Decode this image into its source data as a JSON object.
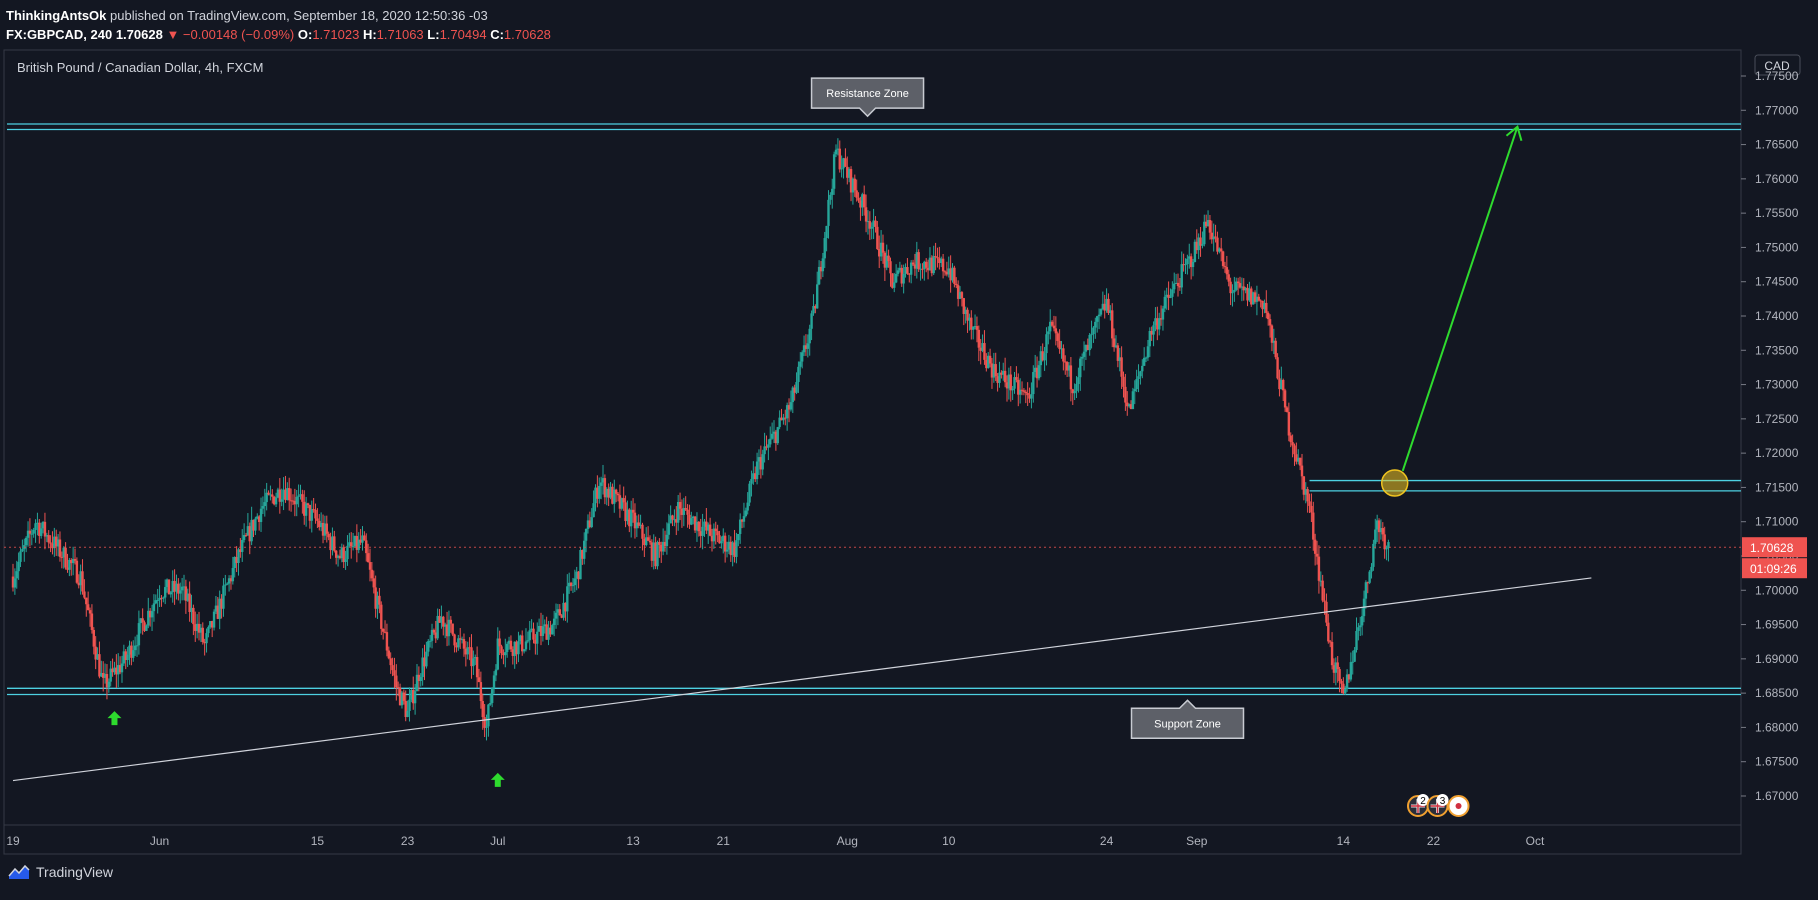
{
  "header": {
    "author": "ThinkingAntsOk",
    "published": "published on TradingView.com, September 18, 2020 12:50:36 -03",
    "symbol_line": "FX:GBPCAD, 240",
    "last": "1.70628",
    "change": "▼ −0.00148 (−0.09%)",
    "o_label": "O:",
    "o": "1.71023",
    "h_label": "H:",
    "h": "1.71063",
    "l_label": "L:",
    "l": "1.70494",
    "c_label": "C:",
    "c": "1.70628"
  },
  "chart_data": {
    "type": "candlestick",
    "title": "British Pound / Canadian Dollar, 4h, FXCM",
    "currency": "CAD",
    "y_ticks": [
      "1.77500",
      "1.77000",
      "1.76500",
      "1.76000",
      "1.75500",
      "1.75000",
      "1.74500",
      "1.74000",
      "1.73500",
      "1.73000",
      "1.72500",
      "1.72000",
      "1.71500",
      "1.71000",
      "1.70500",
      "1.70000",
      "1.69500",
      "1.69000",
      "1.68500",
      "1.68000",
      "1.67500",
      "1.67000"
    ],
    "y_values": [
      1.775,
      1.77,
      1.765,
      1.76,
      1.755,
      1.75,
      1.745,
      1.74,
      1.735,
      1.73,
      1.725,
      1.72,
      1.715,
      1.71,
      1.705,
      1.7,
      1.695,
      1.69,
      1.685,
      1.68,
      1.675,
      1.67
    ],
    "ylim": [
      1.665,
      1.78
    ],
    "x_ticks": [
      "19",
      "Jun",
      "15",
      "23",
      "Jul",
      "13",
      "21",
      "Aug",
      "10",
      "24",
      "Sep",
      "14",
      "22",
      "Oct"
    ],
    "price_path": [
      [
        "2020-05-19",
        1.702
      ],
      [
        "2020-05-21",
        1.71
      ],
      [
        "2020-05-25",
        1.702
      ],
      [
        "2020-05-27",
        1.686
      ],
      [
        "2020-05-29",
        1.69
      ],
      [
        "2020-06-01",
        1.7
      ],
      [
        "2020-06-03",
        1.7
      ],
      [
        "2020-06-05",
        1.692
      ],
      [
        "2020-06-08",
        1.705
      ],
      [
        "2020-06-10",
        1.712
      ],
      [
        "2020-06-12",
        1.715
      ],
      [
        "2020-06-15",
        1.71
      ],
      [
        "2020-06-17",
        1.705
      ],
      [
        "2020-06-19",
        1.707
      ],
      [
        "2020-06-22",
        1.686
      ],
      [
        "2020-06-23",
        1.682
      ],
      [
        "2020-06-24",
        1.688
      ],
      [
        "2020-06-26",
        1.696
      ],
      [
        "2020-06-29",
        1.689
      ],
      [
        "2020-06-30",
        1.68
      ],
      [
        "2020-07-01",
        1.692
      ],
      [
        "2020-07-03",
        1.692
      ],
      [
        "2020-07-06",
        1.695
      ],
      [
        "2020-07-08",
        1.702
      ],
      [
        "2020-07-10",
        1.716
      ],
      [
        "2020-07-13",
        1.71
      ],
      [
        "2020-07-15",
        1.705
      ],
      [
        "2020-07-17",
        1.712
      ],
      [
        "2020-07-20",
        1.708
      ],
      [
        "2020-07-22",
        1.706
      ],
      [
        "2020-07-24",
        1.718
      ],
      [
        "2020-07-27",
        1.727
      ],
      [
        "2020-07-29",
        1.74
      ],
      [
        "2020-07-31",
        1.764
      ],
      [
        "2020-08-03",
        1.754
      ],
      [
        "2020-08-05",
        1.745
      ],
      [
        "2020-08-07",
        1.748
      ],
      [
        "2020-08-10",
        1.747
      ],
      [
        "2020-08-12",
        1.738
      ],
      [
        "2020-08-14",
        1.732
      ],
      [
        "2020-08-17",
        1.728
      ],
      [
        "2020-08-19",
        1.738
      ],
      [
        "2020-08-21",
        1.73
      ],
      [
        "2020-08-24",
        1.742
      ],
      [
        "2020-08-26",
        1.726
      ],
      [
        "2020-08-28",
        1.738
      ],
      [
        "2020-09-01",
        1.75
      ],
      [
        "2020-09-02",
        1.754
      ],
      [
        "2020-09-04",
        1.744
      ],
      [
        "2020-09-07",
        1.742
      ],
      [
        "2020-09-09",
        1.725
      ],
      [
        "2020-09-11",
        1.712
      ],
      [
        "2020-09-13",
        1.69
      ],
      [
        "2020-09-14",
        1.684
      ],
      [
        "2020-09-16",
        1.7
      ],
      [
        "2020-09-17",
        1.71
      ],
      [
        "2020-09-18",
        1.70628
      ]
    ],
    "current_price": "1.70628",
    "countdown": "01:09:26",
    "resistance_zone": [
      1.7672,
      1.768
    ],
    "breakout_zone": [
      1.7145,
      1.716
    ],
    "support_zone": [
      1.6848,
      1.6857
    ],
    "trendline": [
      [
        "2020-05-19",
        1.674
      ],
      [
        "2020-10-06",
        1.7018
      ]
    ],
    "target_arrow": [
      [
        "2020-09-19",
        1.7155
      ],
      [
        "2020-09-29",
        1.7676
      ]
    ],
    "annotations": [
      {
        "text": "Resistance Zone",
        "date": "2020-08-02",
        "price": 1.7725
      },
      {
        "text": "Support Zone",
        "date": "2020-08-31",
        "price": 1.6806
      }
    ],
    "markers": [
      {
        "date": "2020-05-28",
        "price": 1.6812,
        "type": "up-arrow"
      },
      {
        "date": "2020-07-01",
        "price": 1.6722,
        "type": "up-arrow"
      }
    ],
    "events": [
      {
        "date": "2020-09-20",
        "count": "2"
      },
      {
        "date": "2020-09-22",
        "count": "3"
      }
    ],
    "colors": {
      "background": "#131722",
      "up": "#26a69a",
      "down": "#ef5350",
      "zone": "#4dd0e1",
      "trendline": "#d1d4dc",
      "arrow": "#2edb2e",
      "circle": "#f0c420",
      "label_bg": "#5d6068"
    }
  },
  "footer": {
    "brand": "TradingView"
  }
}
